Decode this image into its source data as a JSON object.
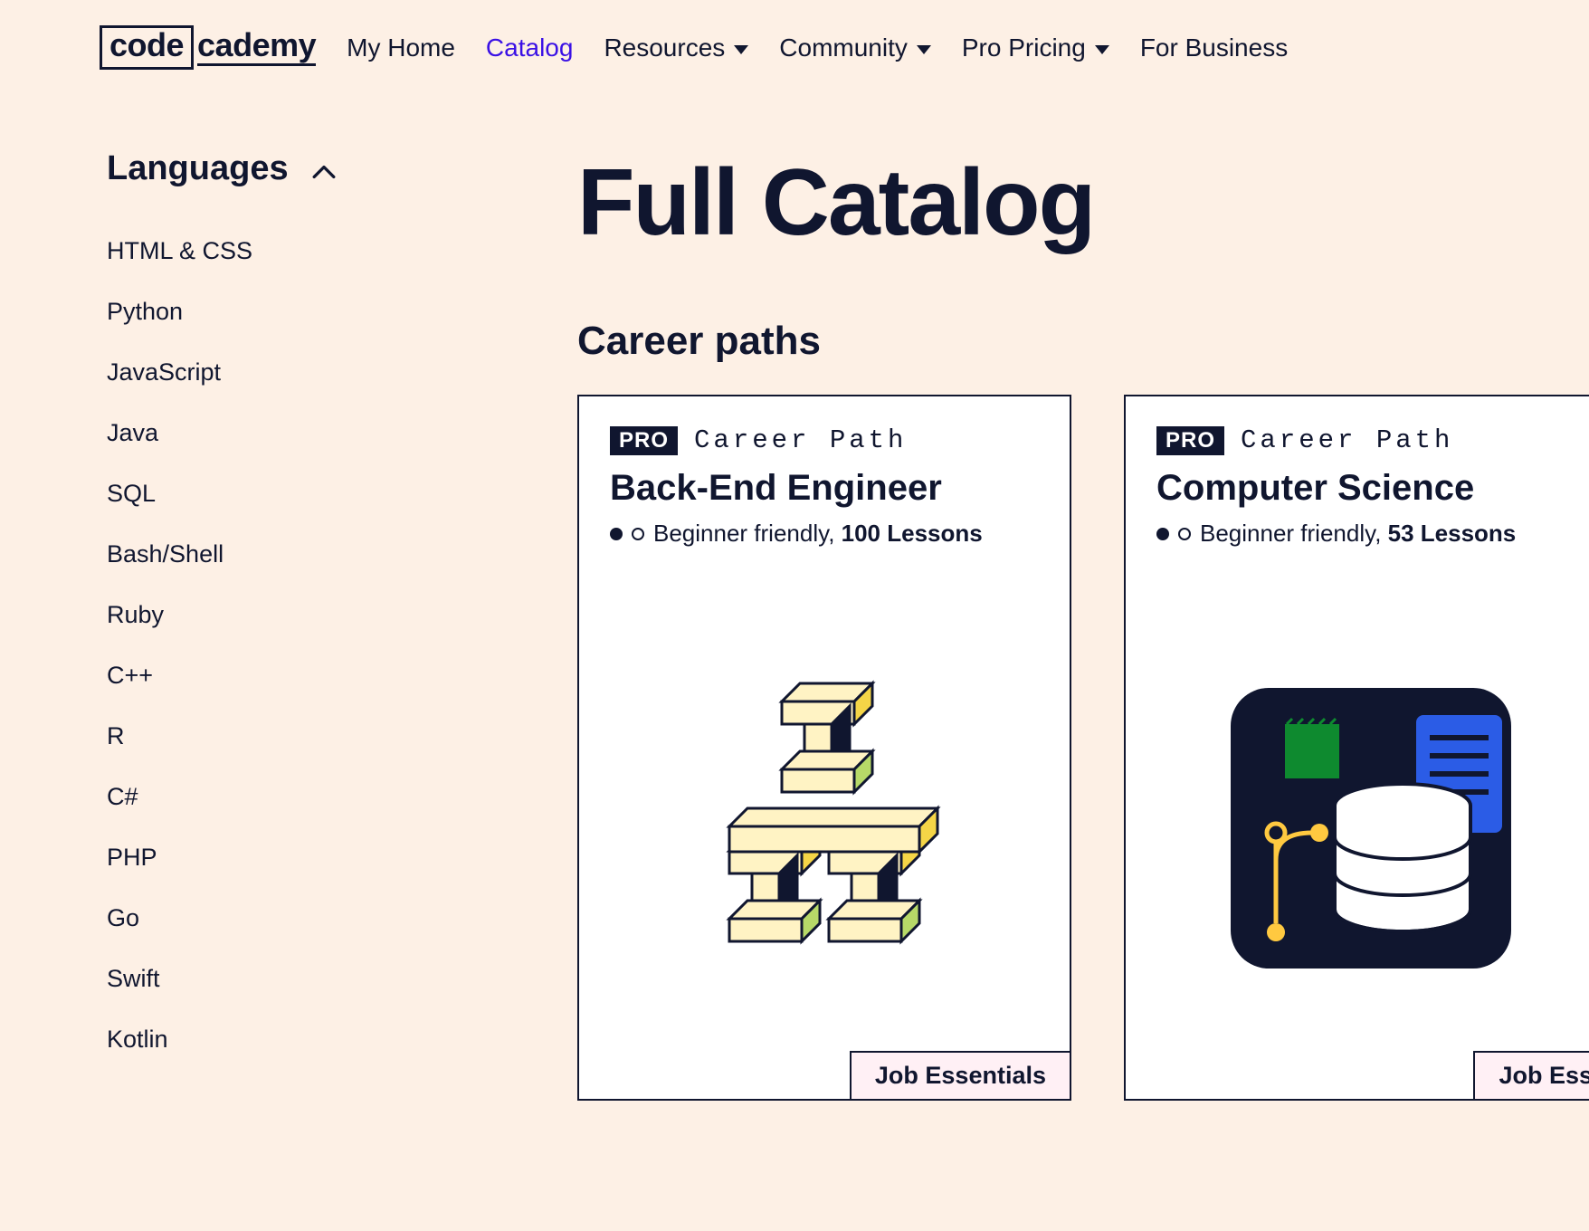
{
  "logo": {
    "left": "code",
    "right": "cademy"
  },
  "nav": {
    "items": [
      {
        "label": "My Home",
        "dropdown": false,
        "active": false
      },
      {
        "label": "Catalog",
        "dropdown": false,
        "active": true
      },
      {
        "label": "Resources",
        "dropdown": true,
        "active": false
      },
      {
        "label": "Community",
        "dropdown": true,
        "active": false
      },
      {
        "label": "Pro Pricing",
        "dropdown": true,
        "active": false
      },
      {
        "label": "For Business",
        "dropdown": false,
        "active": false
      }
    ]
  },
  "sidebar": {
    "title": "Languages",
    "items": [
      {
        "label": "HTML & CSS"
      },
      {
        "label": "Python"
      },
      {
        "label": "JavaScript"
      },
      {
        "label": "Java"
      },
      {
        "label": "SQL"
      },
      {
        "label": "Bash/Shell"
      },
      {
        "label": "Ruby"
      },
      {
        "label": "C++"
      },
      {
        "label": "R"
      },
      {
        "label": "C#"
      },
      {
        "label": "PHP"
      },
      {
        "label": "Go"
      },
      {
        "label": "Swift"
      },
      {
        "label": "Kotlin"
      }
    ]
  },
  "main": {
    "title": "Full Catalog",
    "section": "Career paths"
  },
  "cards": [
    {
      "badge": "PRO",
      "type": "Career Path",
      "title": "Back-End Engineer",
      "difficulty": "Beginner friendly",
      "lessons": "100 Lessons",
      "footer": "Job Essentials"
    },
    {
      "badge": "PRO",
      "type": "Career Path",
      "title": "Computer Science",
      "difficulty": "Beginner friendly",
      "lessons": "53 Lessons",
      "footer": "Job Ess"
    }
  ]
}
